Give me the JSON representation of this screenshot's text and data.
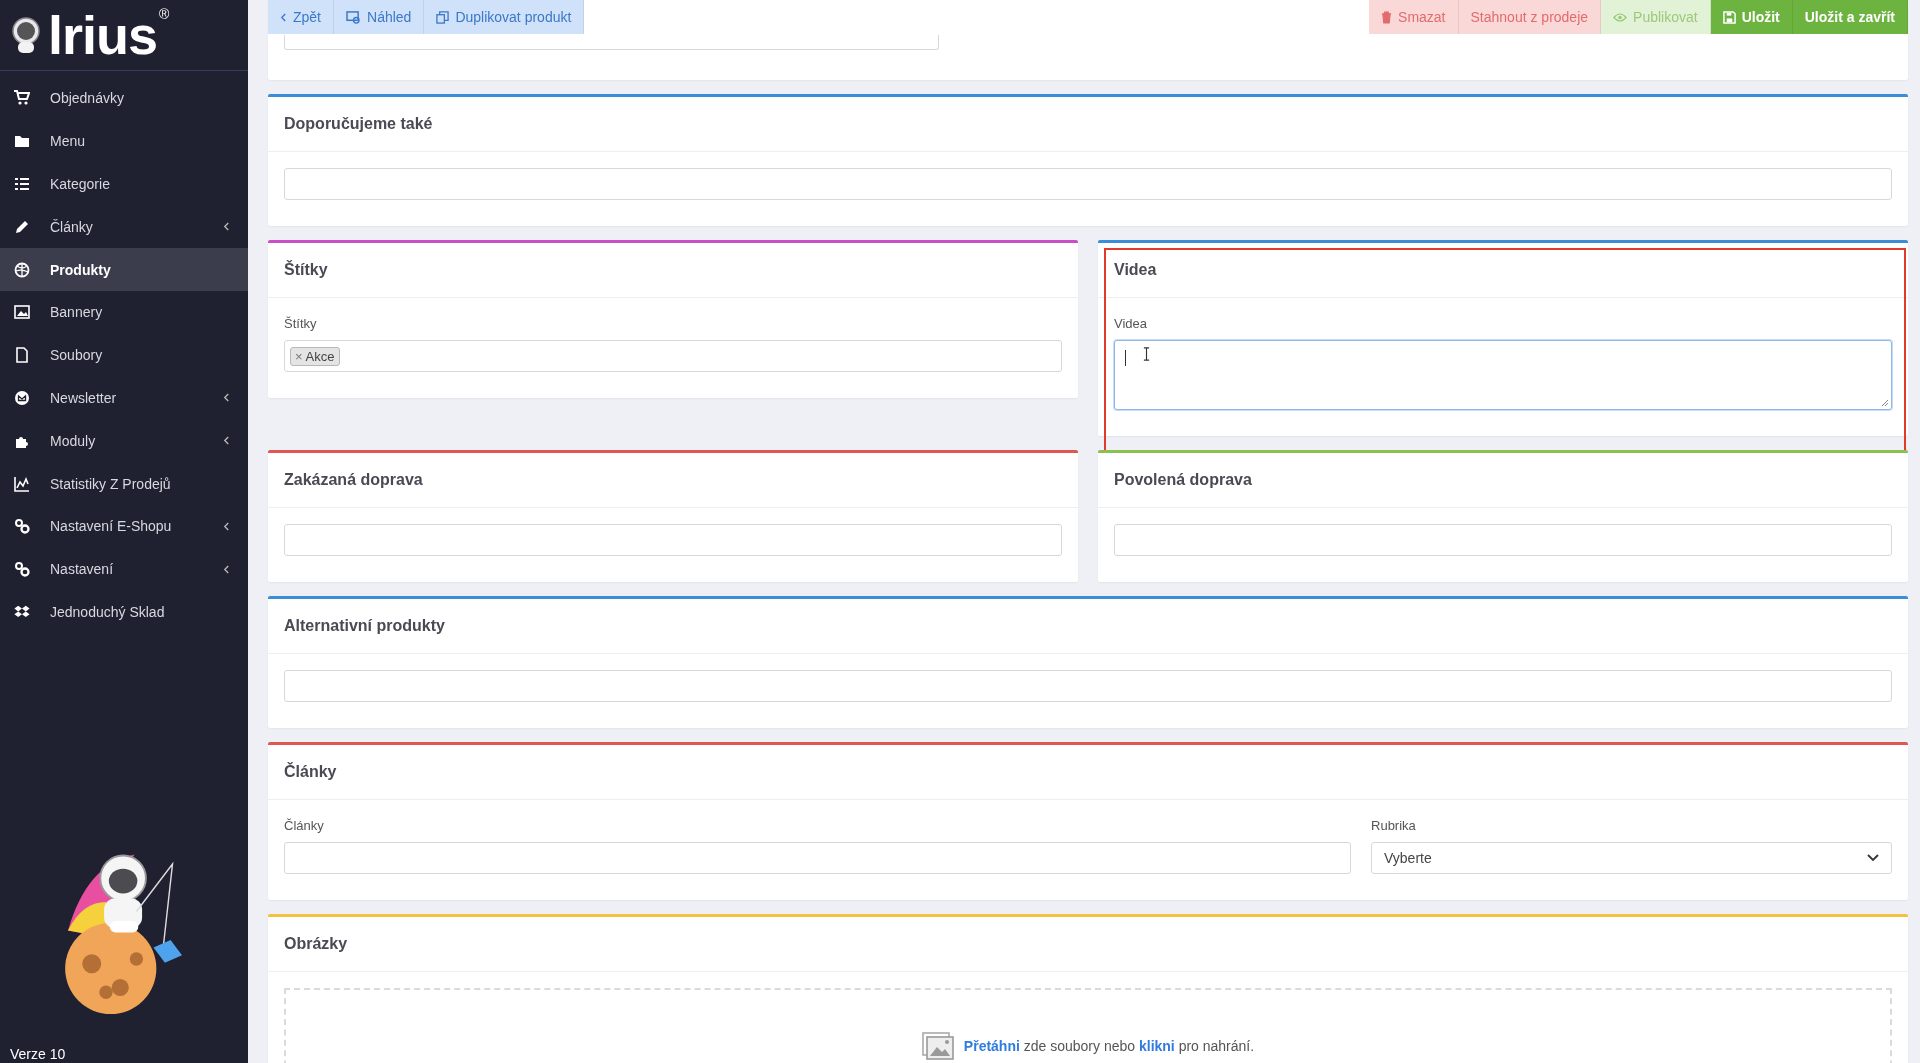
{
  "logo": {
    "text": "lrius",
    "mark": "®"
  },
  "sidebar": {
    "items": [
      {
        "label": "Objednávky",
        "selected": false,
        "expandable": false
      },
      {
        "label": "Menu",
        "selected": false,
        "expandable": false
      },
      {
        "label": "Kategorie",
        "selected": false,
        "expandable": false
      },
      {
        "label": "Články",
        "selected": false,
        "expandable": true
      },
      {
        "label": "Produkty",
        "selected": true,
        "expandable": false
      },
      {
        "label": "Bannery",
        "selected": false,
        "expandable": false
      },
      {
        "label": "Soubory",
        "selected": false,
        "expandable": false
      },
      {
        "label": "Newsletter",
        "selected": false,
        "expandable": true
      },
      {
        "label": "Moduly",
        "selected": false,
        "expandable": true
      },
      {
        "label": "Statistiky Z Prodejů",
        "selected": false,
        "expandable": false
      },
      {
        "label": "Nastavení E-Shopu",
        "selected": false,
        "expandable": true
      },
      {
        "label": "Nastavení",
        "selected": false,
        "expandable": true
      },
      {
        "label": "Jednoduchý Sklad",
        "selected": false,
        "expandable": false
      }
    ],
    "version": "Verze 10"
  },
  "toolbar": {
    "left": [
      {
        "label": "Zpět"
      },
      {
        "label": "Náhled"
      },
      {
        "label": "Duplikovat produkt"
      }
    ],
    "right": [
      {
        "label": "Smazat",
        "kind": "danger"
      },
      {
        "label": "Stahnout z prodeje",
        "kind": "danger"
      },
      {
        "label": "Publikovat",
        "kind": "success-light"
      },
      {
        "label": "Uložit",
        "kind": "success"
      },
      {
        "label": "Uložit a zavřít",
        "kind": "success"
      }
    ]
  },
  "rows": [
    [
      {
        "title": "Doporučujeme také",
        "color": "#3c8dd9",
        "highlighted": false,
        "fields": [
          {
            "kind": "input"
          }
        ]
      }
    ],
    [
      {
        "title": "Štítky",
        "color": "#c94fc4",
        "highlighted": false,
        "fields": [
          {
            "kind": "tags",
            "label": "Štítky",
            "tags": [
              {
                "remove": "×",
                "text": "Akce"
              }
            ]
          }
        ]
      },
      {
        "title": "Videa",
        "color": "#3c8dd9",
        "highlighted": true,
        "fields": [
          {
            "kind": "textarea",
            "label": "Videa",
            "focused": true
          }
        ]
      }
    ],
    [
      {
        "title": "Zakázaná doprava",
        "color": "#e0574f",
        "highlighted": false,
        "fields": [
          {
            "kind": "input"
          }
        ]
      },
      {
        "title": "Povolená doprava",
        "color": "#8cc152",
        "highlighted": false,
        "fields": [
          {
            "kind": "input"
          }
        ]
      }
    ],
    [
      {
        "title": "Alternativní produkty",
        "color": "#3c8dd9",
        "highlighted": false,
        "fields": [
          {
            "kind": "input"
          }
        ]
      }
    ],
    [
      {
        "title": "Články",
        "color": "#e0574f",
        "highlighted": false,
        "fields": [
          {
            "kind": "input",
            "label": "Články"
          },
          {
            "kind": "select",
            "label": "Rubrika",
            "value": "Vyberte"
          }
        ]
      }
    ],
    [
      {
        "title": "Obrázky",
        "color": "#f6c23e",
        "highlighted": false,
        "fields": [
          {
            "kind": "dropzone",
            "parts": [
              {
                "text": "Přetáhni",
                "kind": "link"
              },
              {
                "text": " zde soubory nebo ",
                "kind": "text"
              },
              {
                "text": "klikni",
                "kind": "link"
              },
              {
                "text": " pro nahrání.",
                "kind": "text"
              }
            ]
          }
        ]
      }
    ]
  ]
}
